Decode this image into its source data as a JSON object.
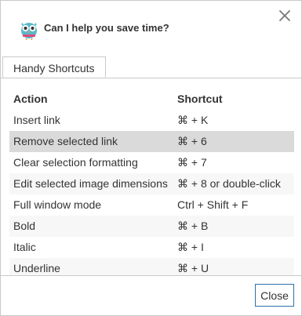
{
  "dialog": {
    "title": "Can I help you save time?",
    "logo_icon": "owl-icon",
    "close_icon": "close-icon"
  },
  "tabs": [
    {
      "label": "Handy Shortcuts"
    }
  ],
  "table": {
    "headers": {
      "action": "Action",
      "shortcut": "Shortcut"
    },
    "rows": [
      {
        "action": "Insert link",
        "shortcut": "⌘ + K"
      },
      {
        "action": "Remove selected link",
        "shortcut": "⌘ + 6"
      },
      {
        "action": "Clear selection formatting",
        "shortcut": "⌘ + 7"
      },
      {
        "action": "Edit selected image dimensions",
        "shortcut": "⌘ + 8 or double-click"
      },
      {
        "action": "Full window mode",
        "shortcut": "Ctrl + Shift + F"
      },
      {
        "action": "Bold",
        "shortcut": "⌘ + B"
      },
      {
        "action": "Italic",
        "shortcut": "⌘ + I"
      },
      {
        "action": "Underline",
        "shortcut": "⌘ + U"
      }
    ]
  },
  "footer": {
    "close_label": "Close"
  },
  "colors": {
    "highlight_row": "#dadada",
    "button_border": "#2f6ea8",
    "owl": "#5bb8c9"
  }
}
